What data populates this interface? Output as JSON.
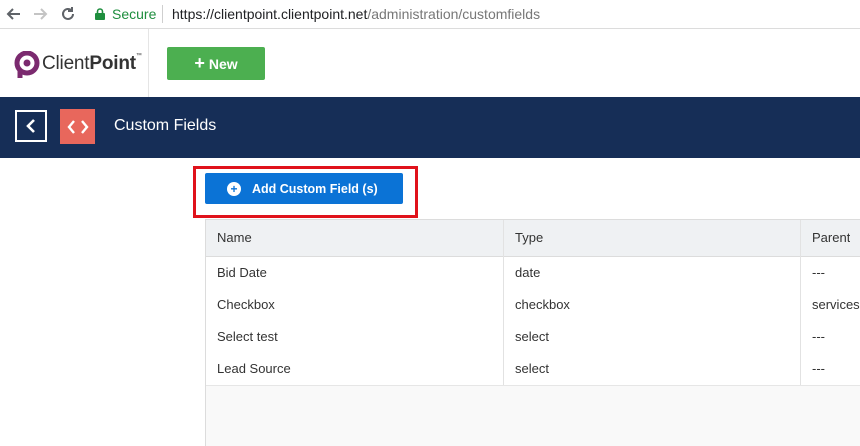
{
  "browser": {
    "secure_label": "Secure",
    "url_host": "https://clientpoint.clientpoint.net",
    "url_path": "/administration/customfields"
  },
  "header": {
    "logo_text_light": "Client",
    "logo_text_bold": "Point",
    "logo_tm": "™",
    "new_button_label": "New"
  },
  "title_bar": {
    "title": "Custom Fields"
  },
  "add_button_label": "Add Custom Field (s)",
  "colors": {
    "title_bar_bg": "#162e57",
    "new_button": "#4caf50",
    "add_button": "#0b73d6",
    "code_icon_bg": "#e8675c",
    "highlight": "#e0121b",
    "logo_accent": "#7b2a6f"
  },
  "table": {
    "headers": [
      "Name",
      "Type",
      "Parent"
    ],
    "rows": [
      [
        "Bid Date",
        "date",
        "---"
      ],
      [
        "Checkbox",
        "checkbox",
        "services"
      ],
      [
        "Select test",
        "select",
        "---"
      ],
      [
        "Lead Source",
        "select",
        "---"
      ]
    ]
  }
}
